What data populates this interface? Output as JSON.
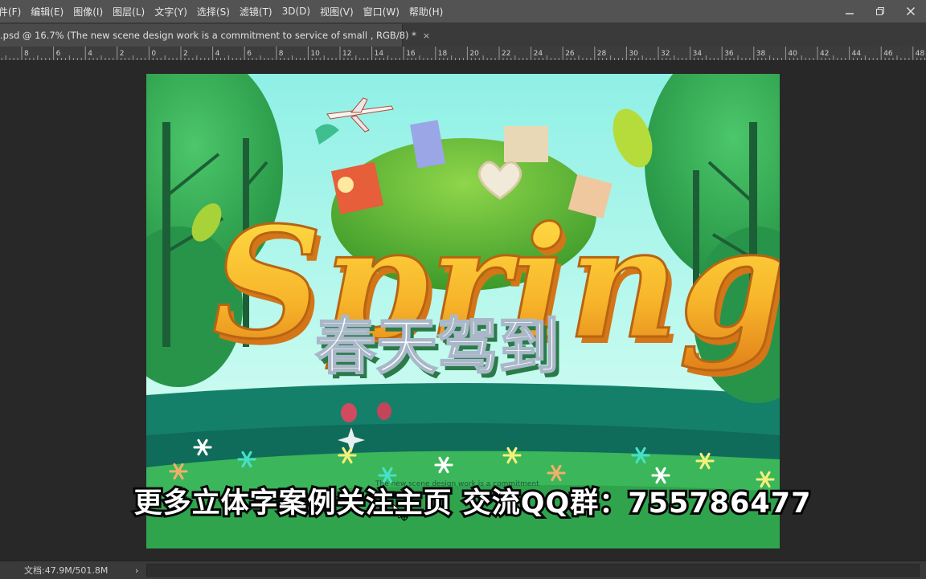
{
  "menubar": {
    "items": [
      "件(F)",
      "编辑(E)",
      "图像(I)",
      "图层(L)",
      "文字(Y)",
      "选择(S)",
      "滤镜(T)",
      "3D(D)",
      "视图(V)",
      "窗口(W)",
      "帮助(H)"
    ]
  },
  "window_controls": {
    "minimize": "—",
    "restore": "❐",
    "close": "✕"
  },
  "document_tab": {
    "label": ".psd @ 16.7% (The new scene design work is a commitment  to service of small , RGB/8) *",
    "close": "×"
  },
  "ruler": {
    "labels": [
      "8",
      "6",
      "4",
      "2",
      "0",
      "2",
      "4",
      "6",
      "8",
      "10",
      "12",
      "14",
      "16",
      "18",
      "20",
      "22",
      "24",
      "26",
      "28",
      "30",
      "32",
      "34",
      "36",
      "38",
      "40",
      "42",
      "44",
      "46",
      "48"
    ]
  },
  "artwork": {
    "headline": "Spring",
    "chinese_title": "春天驾到",
    "small_text": "The new scene design work is a commitment"
  },
  "subtitle": "更多立体字案例关注主页 交流QQ群：755786477",
  "statusbar": {
    "doc_size": "文档:47.9M/501.8M",
    "arrow": "›"
  },
  "colors": {
    "menubar": "#535353",
    "workspace": "#282828",
    "sky": "#9ff0e4",
    "grass_dark": "#0f6b5a",
    "grass_light": "#3bb65a",
    "tree_green": "#2e9e48",
    "letter_orange": "#f5a623",
    "letter_yellow": "#ffd23c"
  }
}
